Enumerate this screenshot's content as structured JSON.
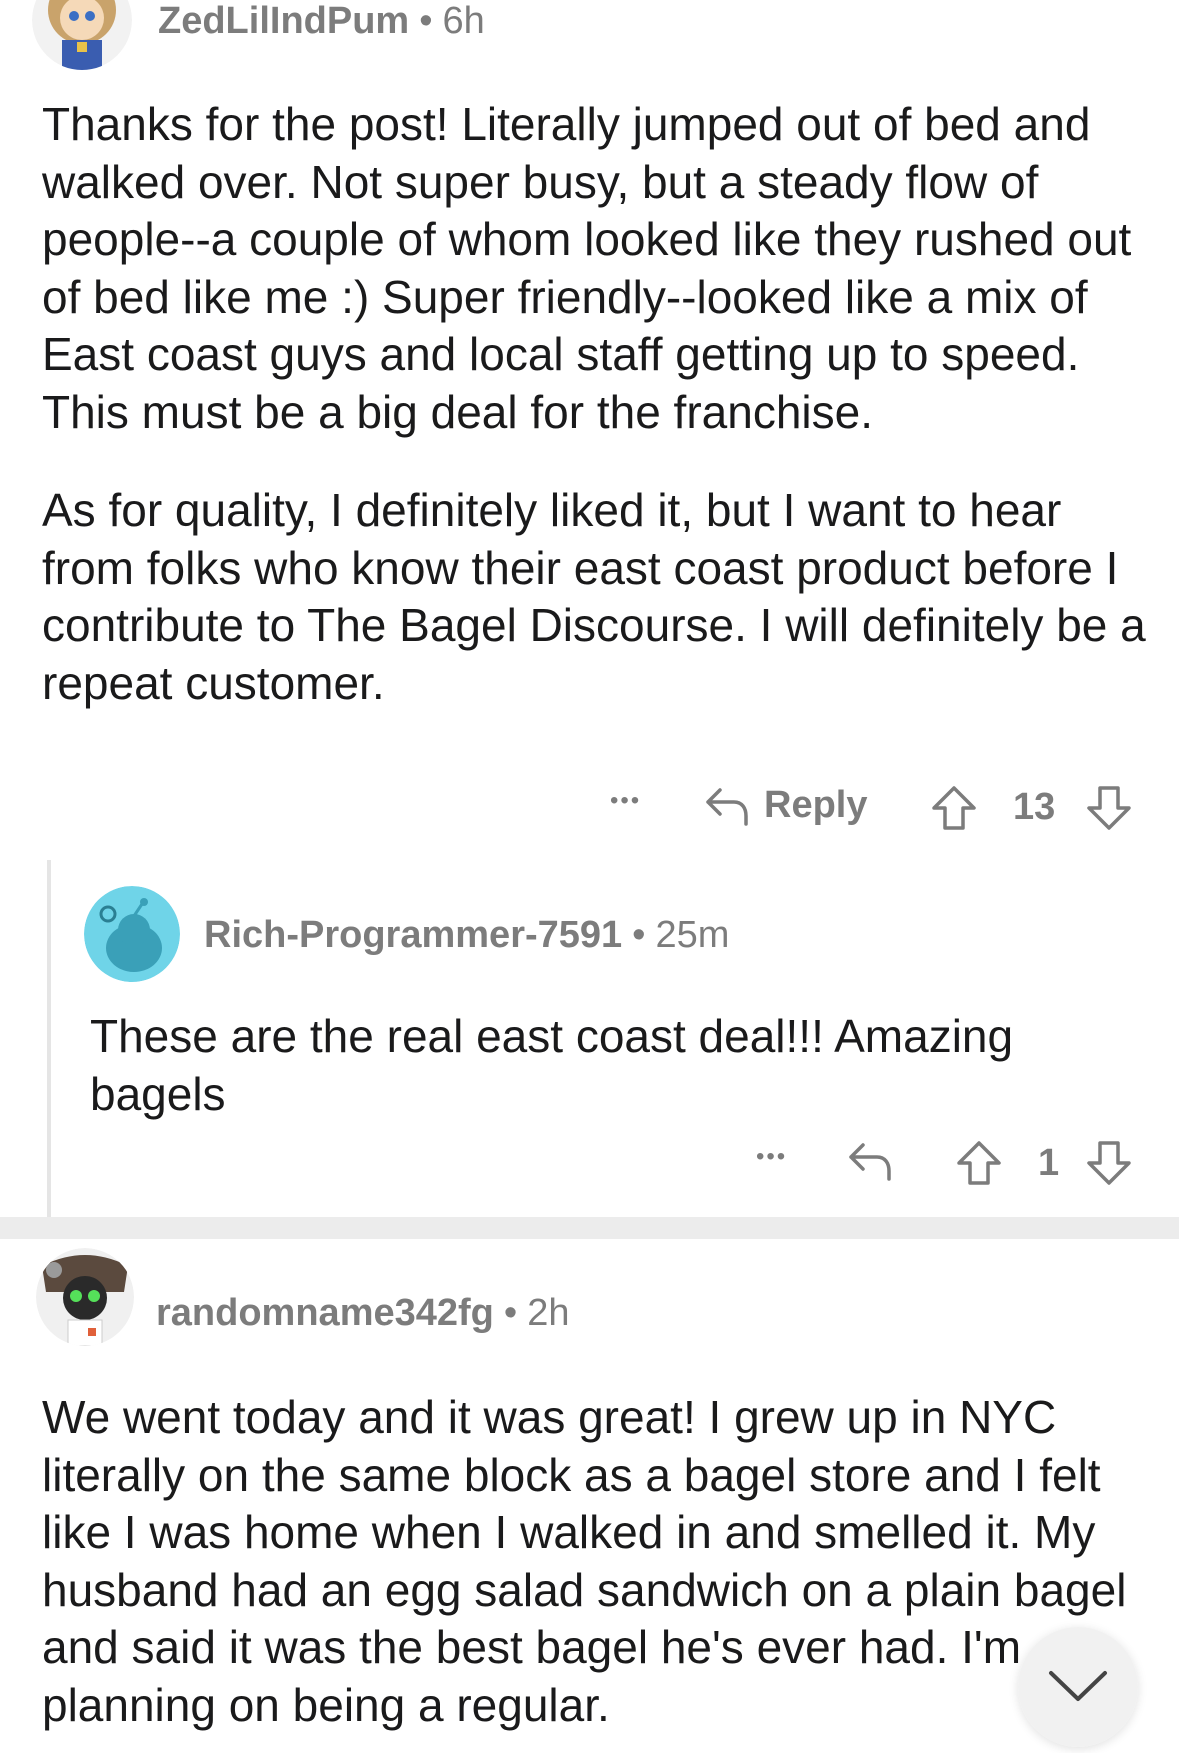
{
  "comments": [
    {
      "username": "ZedLilIndPum",
      "age": "6h",
      "paragraphs": [
        "Thanks for the post! Literally jumped out of bed and walked over. Not super busy, but a steady flow of people--a couple of whom looked like they rushed out of bed like me :) Super friendly--looked like a mix of East coast guys and local staff getting up to speed. This must be a big deal for the franchise.",
        "As for quality, I definitely liked it, but I want to hear from folks who know their east coast product before I contribute to The Bagel Discourse. I will definitely be a repeat customer."
      ],
      "more_label": "•••",
      "reply_label": "Reply",
      "score": "13",
      "reply": {
        "username": "Rich-Programmer-7591",
        "age": "25m",
        "text": "These are the real east coast deal!!! Amazing bagels",
        "more_label": "•••",
        "score": "1"
      }
    },
    {
      "username": "randomname342fg",
      "age": "2h",
      "text": "We went today and it was great! I grew up in NYC literally on the same block as a bagel store and I felt like I was home when I walked in and smelled it. My husband had an egg salad sandwich on a plain bagel and said it was the best bagel he's ever had. I'm planning on being a regular."
    }
  ],
  "dot_separator": "•",
  "icons": {
    "reply": "reply-arrow-icon",
    "upvote": "upvote-arrow-icon",
    "downvote": "downvote-arrow-icon",
    "scroll": "chevron-down-icon"
  },
  "colors": {
    "meta_text": "#7c7c7c",
    "body_text": "#1a1a1b",
    "reply_avatar_bg": "#6fd4e8",
    "separator": "#ececec"
  }
}
